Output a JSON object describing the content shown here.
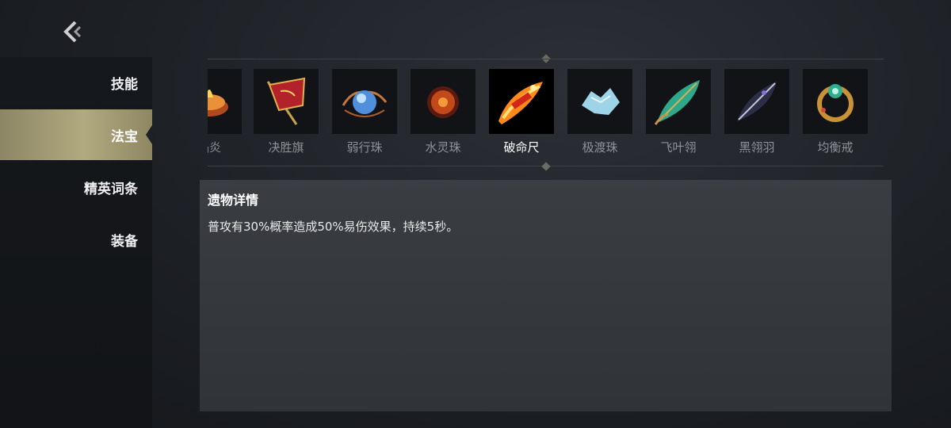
{
  "header": {
    "back_icon": "back-arrow-icon"
  },
  "sidebar": {
    "items": [
      {
        "label": "技能",
        "active": false
      },
      {
        "label": "法宝",
        "active": true
      },
      {
        "label": "精英词条",
        "active": false
      },
      {
        "label": "装备",
        "active": false
      }
    ]
  },
  "relics": [
    {
      "name": "焰炎",
      "icon": "flame-bowl-icon",
      "selected": false
    },
    {
      "name": "决胜旗",
      "icon": "banner-flag-icon",
      "selected": false
    },
    {
      "name": "弱行珠",
      "icon": "blue-orb-icon",
      "selected": false
    },
    {
      "name": "水灵珠",
      "icon": "red-rune-orb-icon",
      "selected": false
    },
    {
      "name": "破命尺",
      "icon": "fire-ruler-icon",
      "selected": true
    },
    {
      "name": "极渡珠",
      "icon": "ice-crystal-icon",
      "selected": false
    },
    {
      "name": "飞叶翎",
      "icon": "jade-leaf-icon",
      "selected": false
    },
    {
      "name": "黑翎羽",
      "icon": "black-feather-icon",
      "selected": false
    },
    {
      "name": "均衡戒",
      "icon": "gem-ring-icon",
      "selected": false
    }
  ],
  "details": {
    "title": "遗物详情",
    "description": "普攻有30%概率造成50%易伤效果，持续5秒。"
  },
  "colors": {
    "active_tab": "#b1a97f",
    "background": "#1d2025",
    "panel": "#36393e"
  }
}
